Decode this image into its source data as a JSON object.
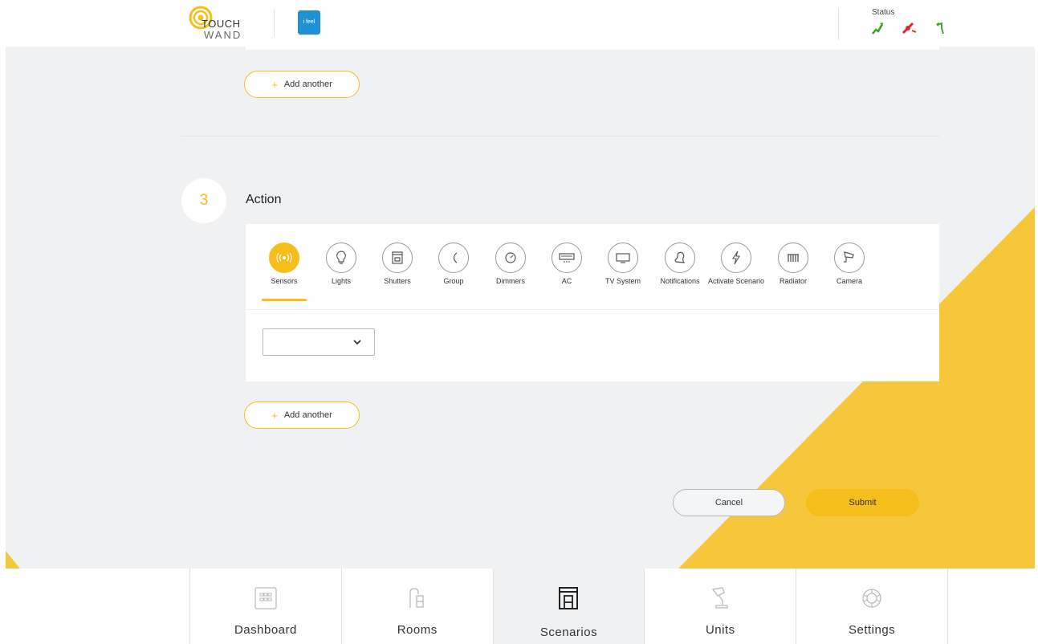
{
  "header": {
    "logo_line1": "TOUCH",
    "logo_line2": "WAND",
    "ifeel_label": "i feel",
    "status_label": "Status"
  },
  "conditions": {
    "add_another_label": "Add another"
  },
  "action_section": {
    "step_number": "3",
    "title": "Action",
    "categories": [
      {
        "label": "Sensors",
        "icon": "sensor-icon"
      },
      {
        "label": "Lights",
        "icon": "bulb-icon"
      },
      {
        "label": "Shutters",
        "icon": "shutter-icon"
      },
      {
        "label": "Group",
        "icon": "group-icon"
      },
      {
        "label": "Dimmers",
        "icon": "dimmer-icon"
      },
      {
        "label": "AC",
        "icon": "ac-icon"
      },
      {
        "label": "TV System",
        "icon": "tv-icon"
      },
      {
        "label": "Notifications",
        "icon": "bell-icon"
      },
      {
        "label": "Activate Scenario",
        "icon": "bolt-icon"
      },
      {
        "label": "Radiator",
        "icon": "radiator-icon"
      },
      {
        "label": "Camera",
        "icon": "camera-icon"
      }
    ],
    "active_category": "Sensors",
    "select_value": "",
    "add_another_label": "Add another"
  },
  "form_actions": {
    "cancel_label": "Cancel",
    "submit_label": "Submit"
  },
  "bottom_nav": {
    "items": [
      {
        "label": "Dashboard",
        "icon": "dashboard-icon"
      },
      {
        "label": "Rooms",
        "icon": "rooms-icon"
      },
      {
        "label": "Scenarios",
        "icon": "scenarios-icon"
      },
      {
        "label": "Units",
        "icon": "units-icon"
      },
      {
        "label": "Settings",
        "icon": "settings-icon"
      }
    ],
    "active": "Scenarios"
  },
  "colors": {
    "accent": "#f6be1a",
    "background": "#eff1f3",
    "ifeel_blue": "#1e90d6"
  }
}
